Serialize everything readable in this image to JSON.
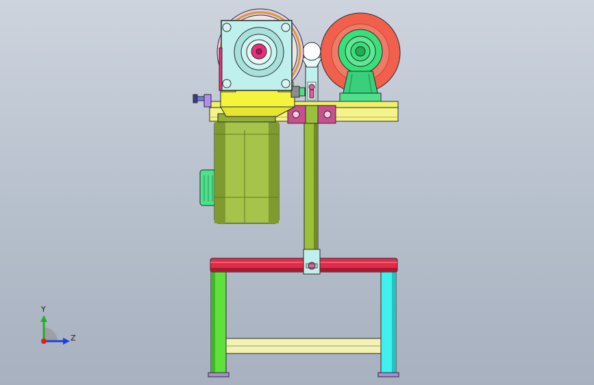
{
  "viewport": {
    "background_top": "#cdd4de",
    "background_bottom": "#a7b1bf"
  },
  "triad": {
    "y_label": "Y",
    "z_label": "Z",
    "y_color": "#1fb21f",
    "z_color": "#1f3fe0",
    "x_color": "#e01f1f"
  },
  "colors": {
    "gearbox_face": "#bff0ee",
    "gearbox_yellow": "#f4f43c",
    "pulley_pink": "#f0c8e8",
    "motor_olive": "#a7c44a",
    "motor_dark": "#7f9a2e",
    "fan_cover": "#4fe08c",
    "wheel_red": "#f0604c",
    "wheel_hub": "#38e07a",
    "rail_yellow": "#f1f06a",
    "column_green": "#9bc03a",
    "bracket_pink": "#c8508e",
    "table_red": "#e02c48",
    "leg_green": "#5fe03c",
    "leg_cyan": "#40f0ec",
    "crossbar": "#f2f2b4",
    "foot_purple": "#a88cd8",
    "outline": "#2a2a2a"
  }
}
